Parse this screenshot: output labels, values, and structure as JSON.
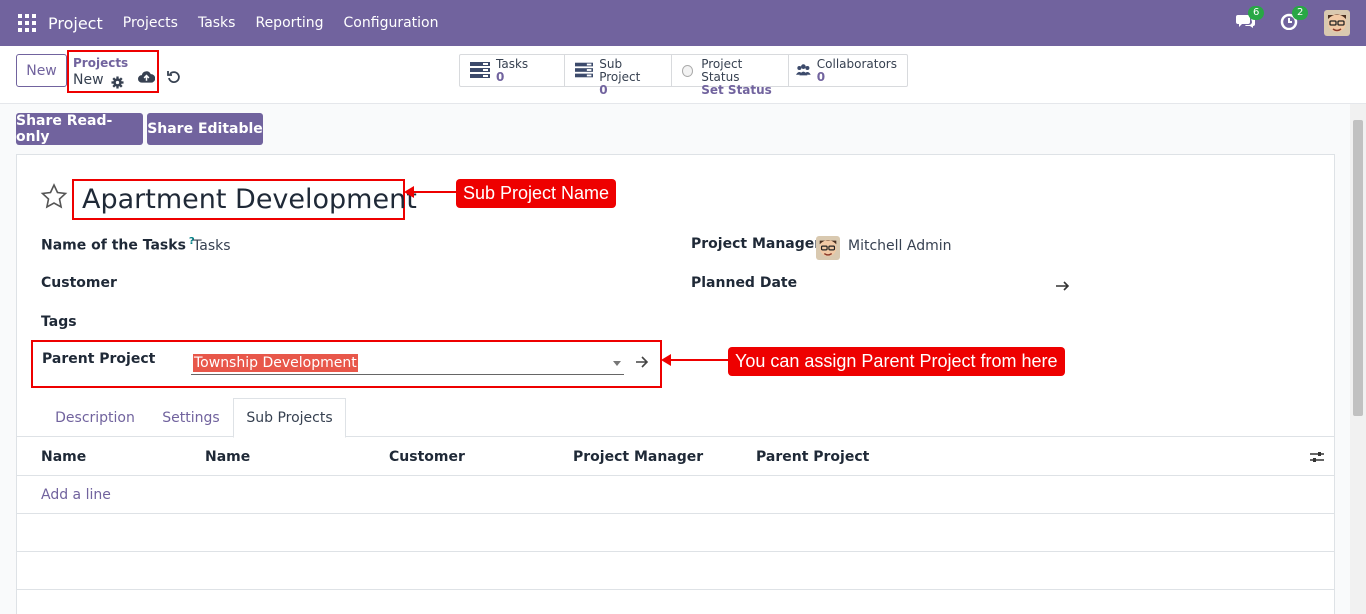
{
  "navbar": {
    "app_name": "Project",
    "menu": [
      "Projects",
      "Tasks",
      "Reporting",
      "Configuration"
    ],
    "messages_count": "6",
    "activities_count": "2"
  },
  "control": {
    "new_label": "New",
    "breadcrumb_parent": "Projects",
    "breadcrumb_current": "New"
  },
  "smart_buttons": {
    "tasks": {
      "label": "Tasks",
      "value": "0"
    },
    "sub_project": {
      "label": "Sub Project",
      "value": "0"
    },
    "status": {
      "label": "Project Status",
      "value": "Set Status"
    },
    "collaborators": {
      "label": "Collaborators",
      "value": "0"
    }
  },
  "share": {
    "read_only": "Share Read-only",
    "editable": "Share Editable"
  },
  "form": {
    "title": "Apartment Development",
    "name_of_tasks_label": "Name of the Tasks",
    "help_mark": "?",
    "name_of_tasks_value": "Tasks",
    "customer_label": "Customer",
    "tags_label": "Tags",
    "parent_project_label": "Parent Project",
    "parent_project_value": "Township Development",
    "project_manager_label": "Project Manager",
    "project_manager_value": "Mitchell Admin",
    "planned_date_label": "Planned Date"
  },
  "annotations": {
    "sub_project_name": "Sub Project Name",
    "parent_project_hint": "You can assign Parent Project from here"
  },
  "tabs": [
    "Description",
    "Settings",
    "Sub Projects"
  ],
  "table": {
    "headers": [
      "Name",
      "Name",
      "Customer",
      "Project Manager",
      "Parent Project"
    ],
    "add_line": "Add a line"
  },
  "colors": {
    "brand": "#71639e",
    "annotation": "#ee0000",
    "badge": "#28a745"
  }
}
